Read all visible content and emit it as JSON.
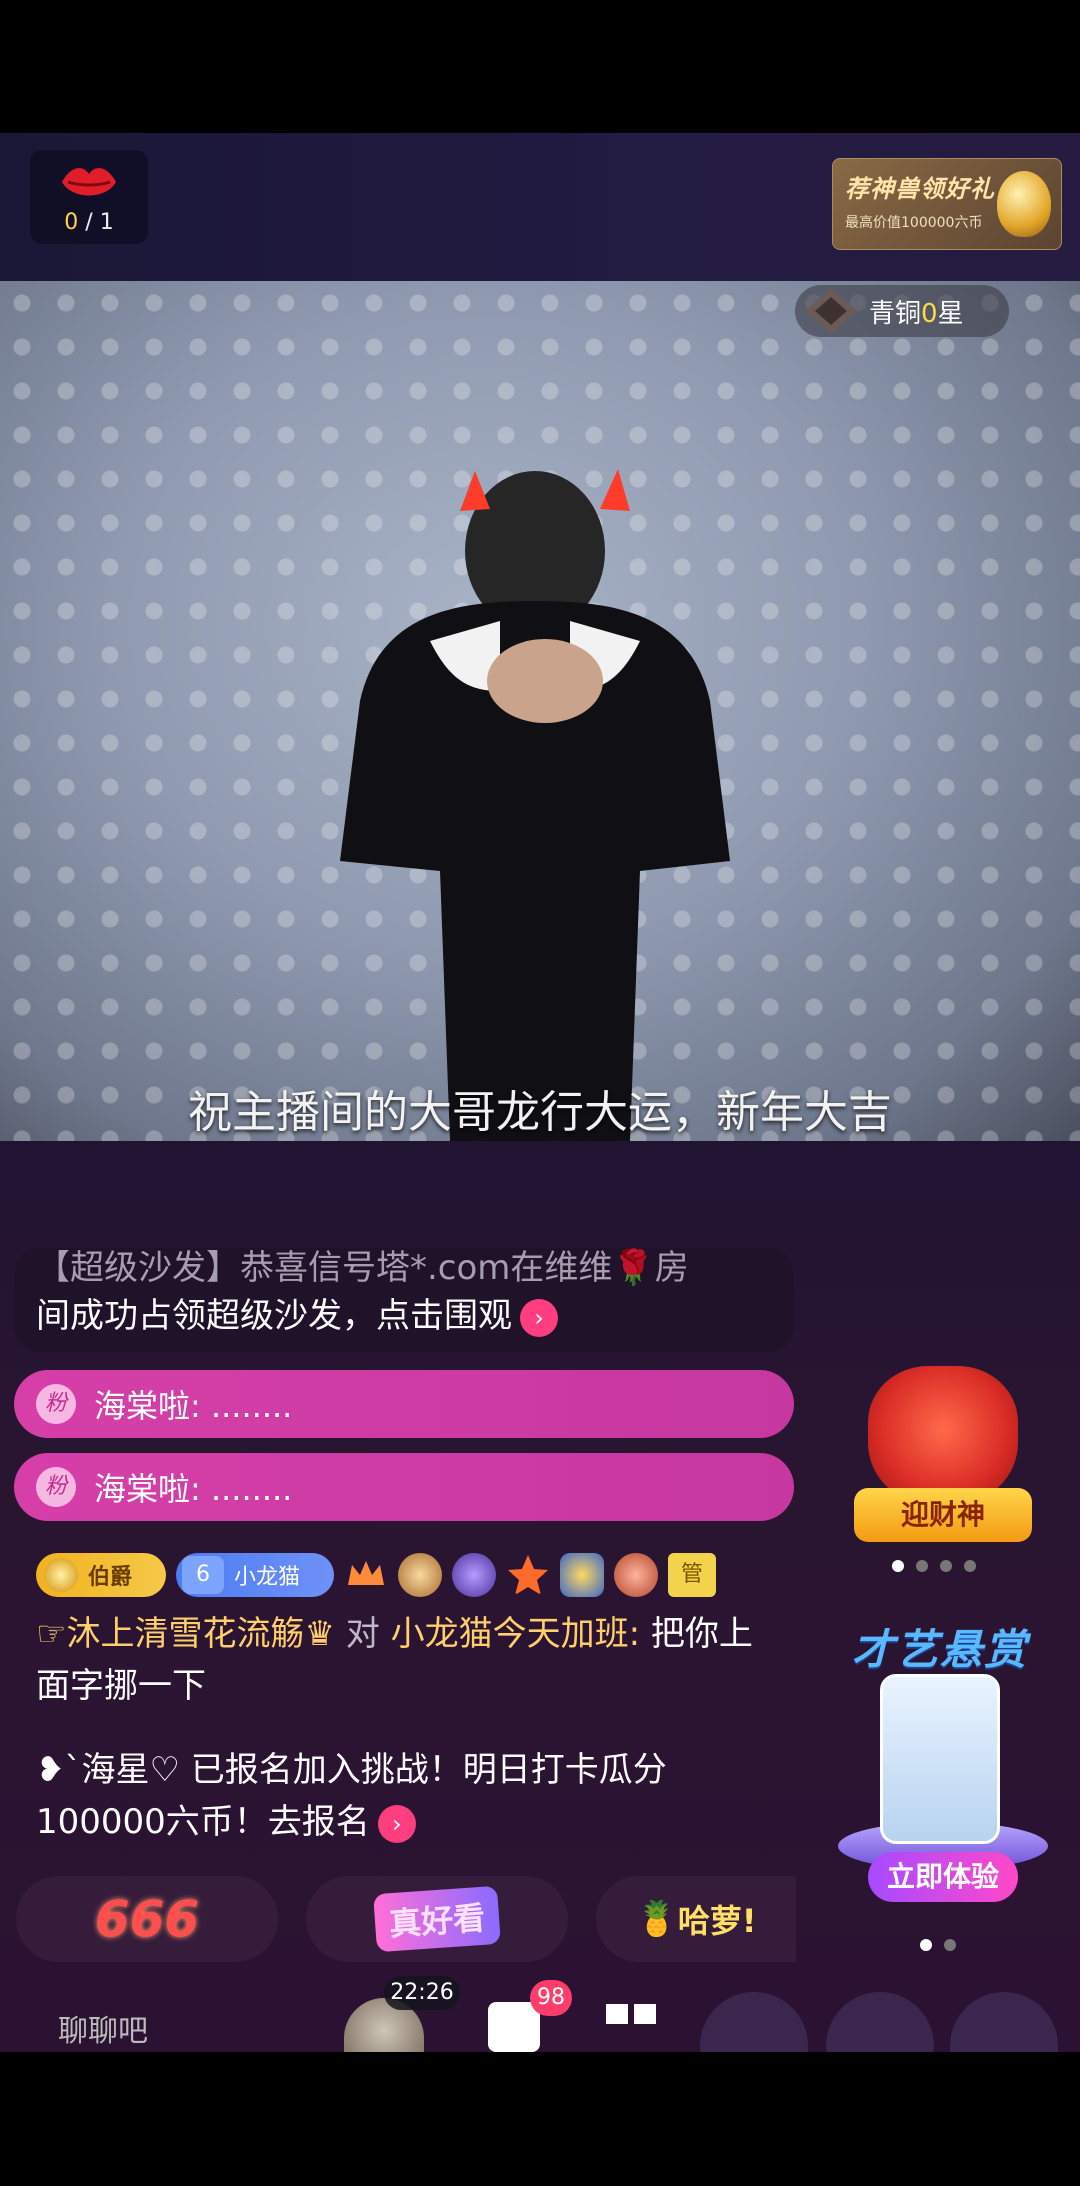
{
  "top": {
    "gift_counter": {
      "current": "0",
      "total": "/ 1"
    },
    "promo": {
      "title": "荐神兽领好礼",
      "subtitle": "最高价值100000六币"
    }
  },
  "video": {
    "subtitle": "祝主播间的大哥龙行大运，新年大吉",
    "rank_badge": {
      "prefix": "青铜",
      "level": "0",
      "suffix": "星"
    }
  },
  "chat": {
    "system_message": {
      "line1": "【超级沙发】恭喜信号塔*.com在维维🌹房",
      "line2": "间成功占领超级沙发，点击围观",
      "arrow": "›"
    },
    "fan_messages": [
      {
        "tag": "粉",
        "text": "海棠啦: ........"
      },
      {
        "tag": "粉",
        "text": "海棠啦: ........"
      }
    ],
    "badges": {
      "rank": "伯爵",
      "fan_level": "6",
      "fan_name": "小龙猫",
      "manager": "管"
    },
    "message": {
      "user": "☞沐上清雪花流觞♛",
      "verb": " 对 ",
      "target": "小龙猫今天加班:",
      "text": " 把你上面字挪一下"
    },
    "challenge": {
      "user": "❥`海星♡",
      "text": " 已报名加入挑战！明日打卡瓜分100000六币！去报名",
      "arrow": "›"
    }
  },
  "quick_replies": [
    "666",
    "真好看",
    "哈萝!"
  ],
  "side": {
    "fortune_button": "迎财神",
    "talent_title": "才艺悬赏",
    "talent_button": "立即体验"
  },
  "bottom": {
    "chat_placeholder": "聊聊吧",
    "time": "22:26",
    "unread": "98"
  },
  "colors": {
    "accent_pink": "#d63fa8",
    "gold": "#ffd34a",
    "bg": "#2a1531"
  }
}
